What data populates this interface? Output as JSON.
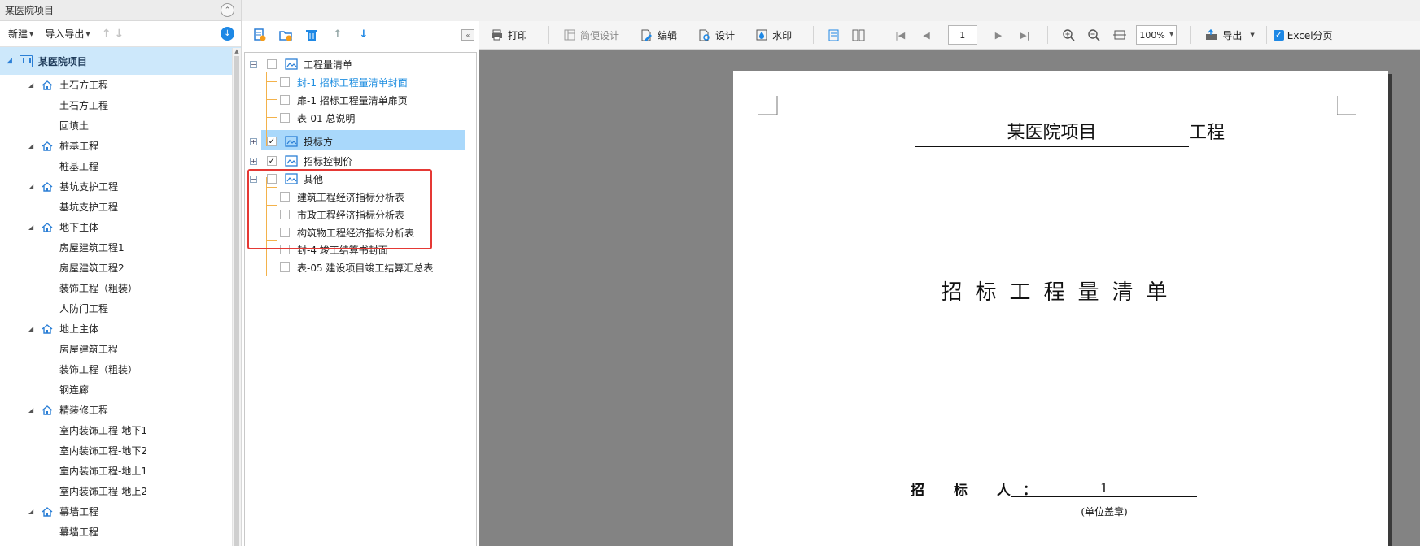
{
  "left": {
    "title": "某医院项目",
    "toolbar": {
      "new_label": "新建",
      "import_export_label": "导入导出"
    },
    "root": "某医院项目",
    "tree": [
      {
        "type": "group",
        "label": "土石方工程"
      },
      {
        "type": "leaf",
        "label": "土石方工程"
      },
      {
        "type": "leaf",
        "label": "回填土"
      },
      {
        "type": "group",
        "label": "桩基工程"
      },
      {
        "type": "leaf",
        "label": "桩基工程"
      },
      {
        "type": "group",
        "label": "基坑支护工程"
      },
      {
        "type": "leaf",
        "label": "基坑支护工程"
      },
      {
        "type": "group",
        "label": "地下主体"
      },
      {
        "type": "leaf",
        "label": "房屋建筑工程1"
      },
      {
        "type": "leaf",
        "label": "房屋建筑工程2"
      },
      {
        "type": "leaf",
        "label": "装饰工程（粗装）"
      },
      {
        "type": "leaf",
        "label": "人防门工程"
      },
      {
        "type": "group",
        "label": "地上主体"
      },
      {
        "type": "leaf",
        "label": "房屋建筑工程"
      },
      {
        "type": "leaf",
        "label": "装饰工程（粗装）"
      },
      {
        "type": "leaf",
        "label": "钢连廊"
      },
      {
        "type": "group",
        "label": "精装修工程"
      },
      {
        "type": "leaf",
        "label": "室内装饰工程-地下1"
      },
      {
        "type": "leaf",
        "label": "室内装饰工程-地下2"
      },
      {
        "type": "leaf",
        "label": "室内装饰工程-地上1"
      },
      {
        "type": "leaf",
        "label": "室内装饰工程-地上2"
      },
      {
        "type": "group",
        "label": "幕墙工程"
      },
      {
        "type": "leaf",
        "label": "幕墙工程"
      }
    ]
  },
  "mid": {
    "nodes": {
      "gcl": "工程量清单",
      "f1": "封-1  招标工程量清单封面",
      "p1": "扉-1  招标工程量清单扉页",
      "b01": "表-01  总说明",
      "tbf": "投标方",
      "zbkzj": "招标控制价",
      "qt": "其他",
      "jz": "建筑工程经济指标分析表",
      "sz": "市政工程经济指标分析表",
      "gzw": "构筑物工程经济指标分析表",
      "f4": "封-4  竣工结算书封面",
      "b05": "表-05  建设项目竣工结算汇总表"
    }
  },
  "toolbar": {
    "print": "打印",
    "simple_design": "简便设计",
    "edit": "编辑",
    "design": "设计",
    "watermark": "水印",
    "page": "1",
    "zoom": "100%",
    "export": "导出",
    "excel_paging": "Excel分页"
  },
  "paper": {
    "project_name": "某医院项目",
    "project_suffix": "工程",
    "main_title": "招标工程量清单",
    "tenderer_label": "招 标 人：",
    "tenderer_value": "1",
    "seal_note": "(单位盖章)"
  },
  "colors": {
    "accent": "#1e88e5",
    "selection": "#a9d8fb",
    "highlight_box": "#e53935",
    "tree_line": "#f3b24b"
  }
}
